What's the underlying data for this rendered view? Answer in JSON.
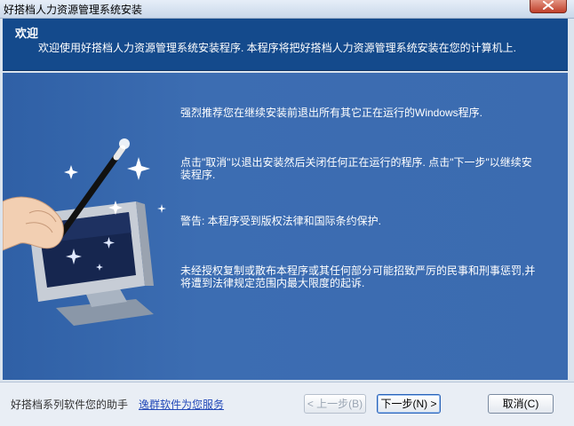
{
  "window": {
    "title": "好搭档人力资源管理系统安装"
  },
  "header": {
    "title": "欢迎",
    "description": "欢迎使用好搭档人力资源管理系统安装程序. 本程序将把好搭档人力资源管理系统安装在您的计算机上."
  },
  "content": {
    "paragraphs": [
      "强烈推荐您在继续安装前退出所有其它正在运行的Windows程序.",
      "点击\"取消\"以退出安装然后关闭任何正在运行的程序. 点击\"下一步\"以继续安装程序.",
      "警告: 本程序受到版权法律和国际条约保护.",
      "未经授权复制或散布本程序或其任何部分可能招致严厉的民事和刑事惩罚,并将遭到法律规定范围内最大限度的起诉."
    ]
  },
  "footer": {
    "tagline": "好搭档系列软件您的助手",
    "link": "逸群软件为您服务",
    "back_label": "< 上一步(B)",
    "next_label": "下一步(N) >",
    "cancel_label": "取消(C)"
  },
  "colors": {
    "header_bg": "#144a8c",
    "content_bg": "#3b6bb0",
    "link": "#2349b8"
  },
  "icons": [
    "close-icon",
    "magic-wand-monitor-illustration"
  ]
}
